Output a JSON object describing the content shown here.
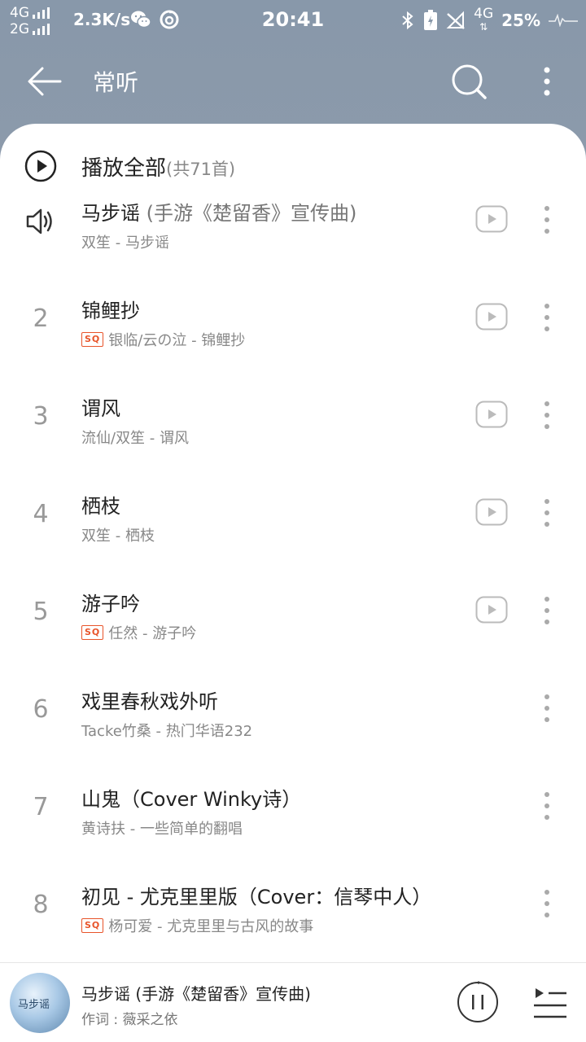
{
  "status_bar": {
    "network_top": "4G",
    "network_bottom": "2G",
    "speed": "2.3K/s",
    "time": "20:41",
    "network_right": "4G",
    "battery": "25%"
  },
  "toolbar": {
    "title": "常听"
  },
  "play_all": {
    "label": "播放全部",
    "count": "(共71首)"
  },
  "songs": [
    {
      "index": "",
      "title": "马步谣",
      "subtitle": " (手游《楚留香》宣传曲)",
      "badge": "",
      "meta": "双笙 - 马步谣",
      "playing": true,
      "has_mv": true
    },
    {
      "index": "2",
      "title": "锦鲤抄",
      "subtitle": "",
      "badge": "SQ",
      "meta": "银临/云の泣 - 锦鲤抄",
      "playing": false,
      "has_mv": true
    },
    {
      "index": "3",
      "title": "谓风",
      "subtitle": "",
      "badge": "",
      "meta": "流仙/双笙 - 谓风",
      "playing": false,
      "has_mv": true
    },
    {
      "index": "4",
      "title": "栖枝",
      "subtitle": "",
      "badge": "",
      "meta": "双笙 - 栖枝",
      "playing": false,
      "has_mv": true
    },
    {
      "index": "5",
      "title": "游子吟",
      "subtitle": "",
      "badge": "SQ",
      "meta": "任然 - 游子吟",
      "playing": false,
      "has_mv": true
    },
    {
      "index": "6",
      "title": "戏里春秋戏外听",
      "subtitle": "",
      "badge": "",
      "meta": "Tacke竹桑 - 热门华语232",
      "playing": false,
      "has_mv": false
    },
    {
      "index": "7",
      "title": "山鬼（Cover Winky诗）",
      "subtitle": "",
      "badge": "",
      "meta": "黄诗扶 - 一些简单的翻唱",
      "playing": false,
      "has_mv": false
    },
    {
      "index": "8",
      "title": "初见 - 尤克里里版（Cover：信琴中人）",
      "subtitle": "",
      "badge": "SQ",
      "meta": "杨可爱 - 尤克里里与古风的故事",
      "playing": false,
      "has_mv": false
    }
  ],
  "mini_player": {
    "title": "马步谣 (手游《楚留香》宣传曲)",
    "subtitle": "作词 : 薇采之依",
    "cover_text": "马步谣"
  },
  "colors": {
    "header": "#8898aa",
    "accent_badge": "#e8542a"
  }
}
